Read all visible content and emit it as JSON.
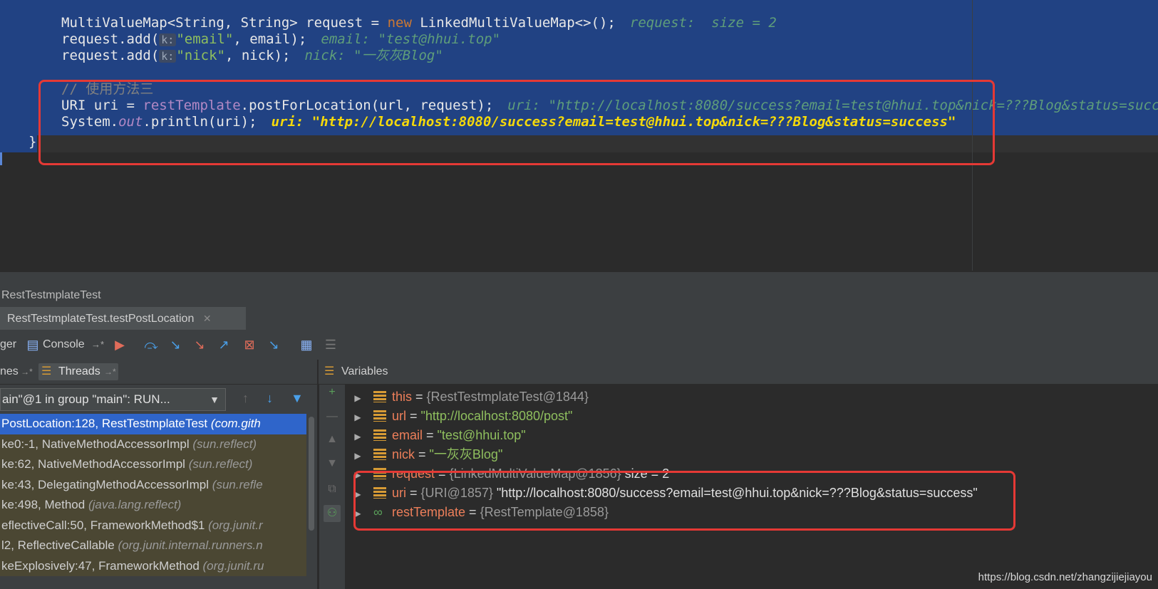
{
  "editor": {
    "line1": {
      "code_a": "MultiValueMap<String, String> request = ",
      "kw_new": "new",
      "code_b": " LinkedMultiValueMap<>();",
      "hint": "request:  size = 2"
    },
    "line2": {
      "code_a": "request.add(",
      "param": "k:",
      "str": "\"email\"",
      "code_b": ", email);",
      "hint": "email: \"test@hhui.top\""
    },
    "line3": {
      "code_a": "request.add(",
      "param": "k:",
      "str": "\"nick\"",
      "code_b": ", nick);",
      "hint": "nick: \"一灰灰Blog\""
    },
    "comment": "// 使用方法三",
    "line5": {
      "code_a": "URI uri = ",
      "field": "restTemplate",
      "code_b": ".postForLocation(url, request);",
      "hint": "uri: \"http://localhost:8080/success?email=test@hhui.top&nick=???Blog&status=succ"
    },
    "line6": {
      "code_a": "System.",
      "field": "out",
      "code_b": ".println(uri);",
      "hint": "uri: \"http://localhost:8080/success?email=test@hhui.top&nick=???Blog&status=success\""
    },
    "closing_brace": "}"
  },
  "debug": {
    "title": "RestTestmplateTest",
    "config_tab": "RestTestmplateTest.testPostLocation",
    "config_close": "✕",
    "toolbar": {
      "debugger_label": "ger",
      "console_label": "Console",
      "pin": "→*"
    },
    "frames_tab": "nes",
    "threads_tab": "Threads",
    "variables_tab": "Variables",
    "thread_select": "ain\"@1 in group \"main\": RUN...",
    "frames": [
      {
        "method": "PostLocation:128, RestTestmplateTest",
        "pkg": "(com.gith"
      },
      {
        "method": "ke0:-1, NativeMethodAccessorImpl",
        "pkg": "(sun.reflect)"
      },
      {
        "method": "ke:62, NativeMethodAccessorImpl",
        "pkg": "(sun.reflect)"
      },
      {
        "method": "ke:43, DelegatingMethodAccessorImpl",
        "pkg": "(sun.refle"
      },
      {
        "method": "ke:498, Method",
        "pkg": "(java.lang.reflect)"
      },
      {
        "method": "eflectiveCall:50, FrameworkMethod$1",
        "pkg": "(org.junit.r"
      },
      {
        "method": "l2, ReflectiveCallable",
        "pkg": "(org.junit.internal.runners.n"
      },
      {
        "method": "keExplosively:47, FrameworkMethod",
        "pkg": "(org.junit.ru"
      }
    ],
    "variables": [
      {
        "name": "this",
        "eq": " = ",
        "ref": "{RestTestmplateTest@1844}",
        "val": ""
      },
      {
        "name": "url",
        "eq": " = ",
        "ref": "",
        "val": "\"http://localhost:8080/post\""
      },
      {
        "name": "email",
        "eq": " = ",
        "ref": "",
        "val": "\"test@hhui.top\""
      },
      {
        "name": "nick",
        "eq": " = ",
        "ref": "",
        "val": "\"一灰灰Blog\""
      },
      {
        "name": "request",
        "eq": " = ",
        "ref": "{LinkedMultiValueMap@1856}",
        "val": " size = 2"
      },
      {
        "name": "uri",
        "eq": " = ",
        "ref": "{URI@1857}",
        "val": " \"http://localhost:8080/success?email=test@hhui.top&nick=???Blog&status=success\""
      },
      {
        "name": "restTemplate",
        "eq": " = ",
        "ref": "{RestTemplate@1858}",
        "val": ""
      }
    ]
  },
  "watermark": "https://blog.csdn.net/zhangzijiejiayou",
  "colors": {
    "selection": "#214283",
    "highlight_box": "#e53935",
    "selected_frame": "#2f65ca",
    "eval_hint": "#f5d90a"
  }
}
